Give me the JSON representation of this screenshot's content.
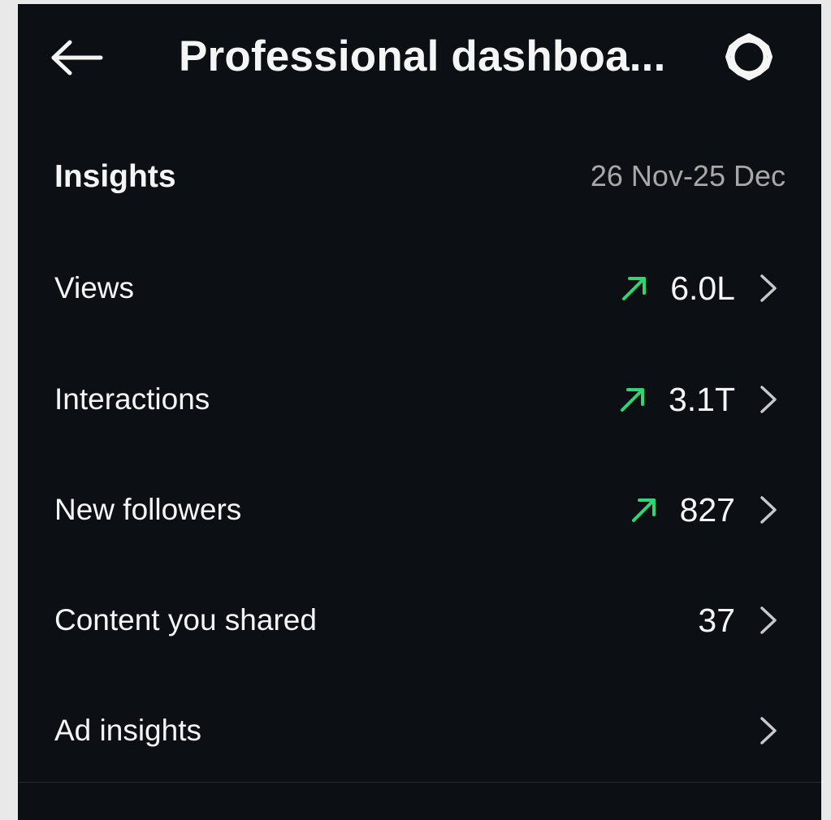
{
  "header": {
    "title": "Professional dashboa...",
    "back_icon": "arrow-left-icon",
    "settings_icon": "gear-icon"
  },
  "insights": {
    "title": "Insights",
    "date_range": "26 Nov-25 Dec",
    "rows": [
      {
        "label": "Views",
        "value": "6.0L",
        "trend": "up"
      },
      {
        "label": "Interactions",
        "value": "3.1T",
        "trend": "up"
      },
      {
        "label": "New followers",
        "value": "827",
        "trend": "up"
      },
      {
        "label": "Content you shared",
        "value": "37",
        "trend": ""
      },
      {
        "label": "Ad insights",
        "value": "",
        "trend": ""
      }
    ]
  },
  "colors": {
    "background": "#0c1014",
    "text": "#f5f5f5",
    "muted": "#a8a8a8",
    "trend_up": "#2ed573",
    "chevron": "#c8c8c8"
  }
}
